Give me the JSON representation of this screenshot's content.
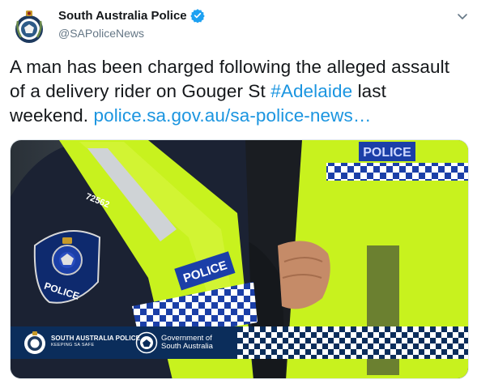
{
  "account": {
    "display_name": "South Australia Police",
    "handle": "@SAPoliceNews",
    "verified": true,
    "avatar_icon": "sa-police-badge-icon"
  },
  "tweet": {
    "text_before_hashtag": "A man has been charged following the alleged assault of a delivery rider on Gouger St ",
    "hashtag": "#Adelaide",
    "text_after_hashtag": " last weekend. ",
    "link": "police.sa.gov.au/sa-police-news…"
  },
  "media": {
    "vest_number": "72562",
    "patch_text": "POLICE",
    "vest_text_left": "POLICE",
    "vest_text_right": "POLICE",
    "banner": {
      "org_name": "SOUTH AUSTRALIA POLICE",
      "org_tagline": "KEEPING SA SAFE",
      "gov_line1": "Government of",
      "gov_line2": "South Australia"
    }
  },
  "colors": {
    "link": "#1b95e0",
    "verified": "#1da1f2",
    "hi_vis": "#c8f21e",
    "navy": "#0b2d5b"
  }
}
